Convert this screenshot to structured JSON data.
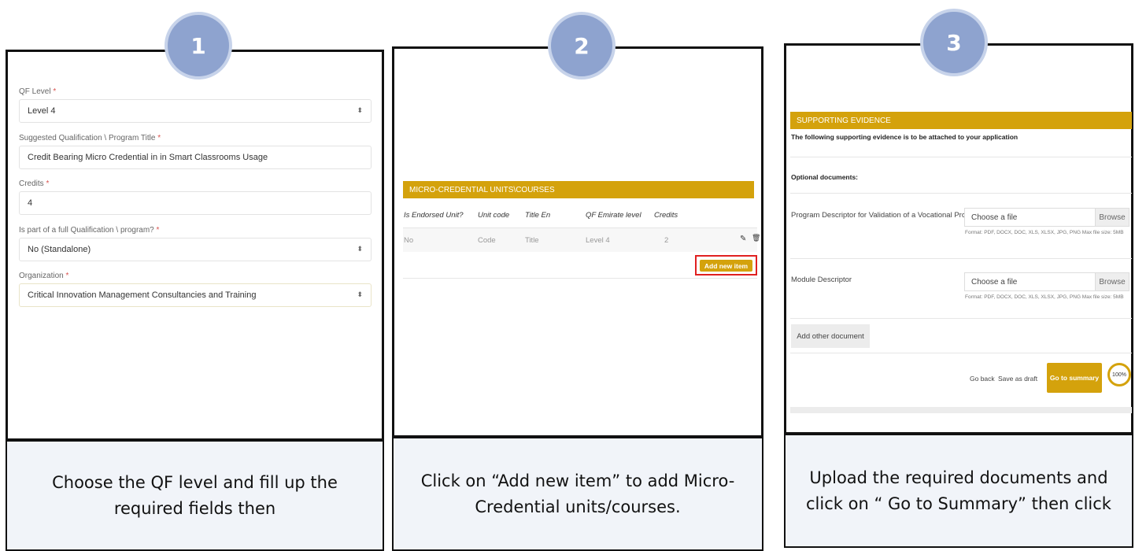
{
  "steps": [
    {
      "number": "1",
      "caption": "Choose the QF level and fill up the required fields then"
    },
    {
      "number": "2",
      "caption": "Click on “Add new item” to add Micro-Credential units/courses."
    },
    {
      "number": "3",
      "caption": "Upload the required documents and click on “ Go to Summary” then click"
    }
  ],
  "form1": {
    "qf_level_label": "QF Level",
    "qf_level_value": "Level 4",
    "title_label": "Suggested Qualification \\ Program Title",
    "title_value": "Credit Bearing Micro Credential in in Smart Classrooms Usage",
    "credits_label": "Credits",
    "credits_value": "4",
    "part_label": "Is part of a full Qualification \\ program?",
    "part_value": "No (Standalone)",
    "org_label": "Organization",
    "org_value": "Critical Innovation Management Consultancies and Training",
    "required_mark": "*"
  },
  "form2": {
    "section_title": "MICRO-CREDENTIAL UNITS\\COURSES",
    "columns": [
      "Is Endorsed Unit?",
      "Unit code",
      "Title En",
      "QF Emirate level",
      "Credits"
    ],
    "rows": [
      [
        "No",
        "Code",
        "Title",
        "Level 4",
        "2"
      ]
    ],
    "add_button": "Add new item"
  },
  "form3": {
    "section_title": "SUPPORTING EVIDENCE",
    "intro": "The following supporting evidence is to be attached to your application",
    "optional_heading": "Optional documents:",
    "docs": [
      {
        "label": "Program Descriptor for Validation of a Vocational Program",
        "placeholder": "Choose a file",
        "browse": "Browse",
        "format": "Format: PDF, DOCX, DOC, XLS, XLSX, JPG, PNG Max file size: 5MB"
      },
      {
        "label": "Module Descriptor",
        "placeholder": "Choose a file",
        "browse": "Browse",
        "format": "Format: PDF, DOCX, DOC, XLS, XLSX, JPG, PNG Max file size: 5MB"
      }
    ],
    "add_other": "Add other document",
    "go_back": "Go back",
    "save_draft": "Save as draft",
    "go_summary": "Go to summary",
    "progress": "100%"
  },
  "colors": {
    "accent": "#d4a20c",
    "badge": "#8ea3cf",
    "caption_bg": "#f1f4f9"
  }
}
